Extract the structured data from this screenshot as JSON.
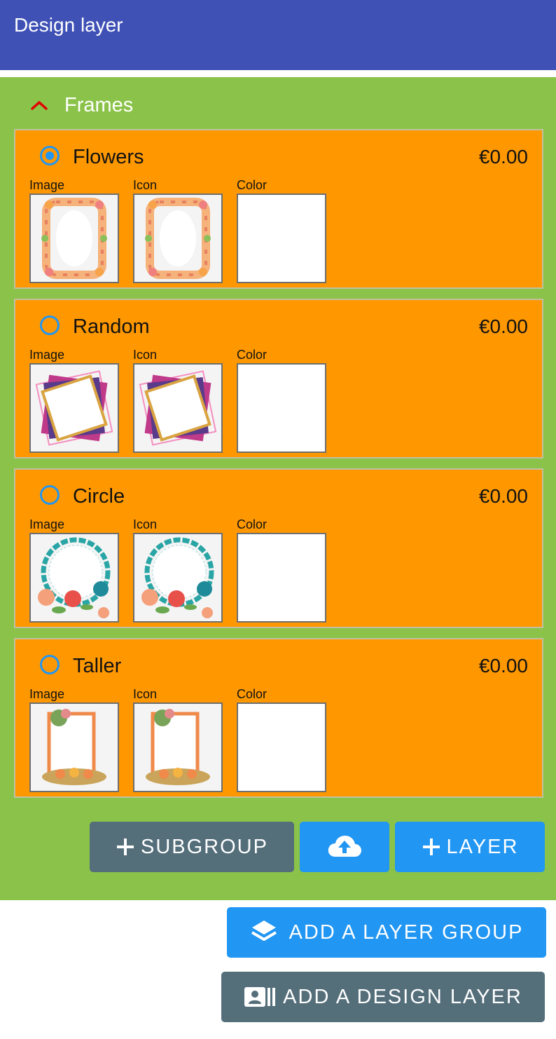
{
  "header": {
    "title": "Design layer"
  },
  "group": {
    "title": "Frames",
    "expand_icon": "chevron-up-icon"
  },
  "items": [
    {
      "name": "Flowers",
      "price": "€0.00",
      "selected": true,
      "labels": {
        "image": "Image",
        "icon": "Icon",
        "color": "Color"
      }
    },
    {
      "name": "Random",
      "price": "€0.00",
      "selected": false,
      "labels": {
        "image": "Image",
        "icon": "Icon",
        "color": "Color"
      }
    },
    {
      "name": "Circle",
      "price": "€0.00",
      "selected": false,
      "labels": {
        "image": "Image",
        "icon": "Icon",
        "color": "Color"
      }
    },
    {
      "name": "Taller",
      "price": "€0.00",
      "selected": false,
      "labels": {
        "image": "Image",
        "icon": "Icon",
        "color": "Color"
      }
    }
  ],
  "actions": {
    "subgroup_label": "SUBGROUP",
    "layer_label": "LAYER",
    "upload_icon": "cloud-upload-icon",
    "add_layer_group_label": "ADD A LAYER GROUP",
    "add_design_layer_label": "ADD A DESIGN LAYER"
  },
  "colors": {
    "header": "#3f51b5",
    "group_bg": "#8bc34a",
    "card_bg": "#ff9800",
    "radio": "#2196f3",
    "button_gray": "#546e7a",
    "button_blue": "#2196f3",
    "chevron": "#e00000"
  }
}
